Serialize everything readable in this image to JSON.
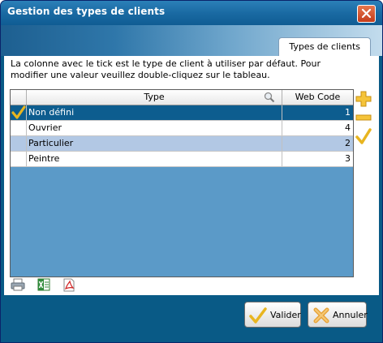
{
  "window": {
    "title": "Gestion des types de clients"
  },
  "banner": {
    "tab_label": "Types de clients"
  },
  "description": "La colonne avec le tick est le type de client à utiliser par défaut. Pour modifier une valeur veuillez double-cliquez sur le tableau.",
  "grid": {
    "columns": [
      "Type",
      "Web Code"
    ],
    "rows": [
      {
        "type": "Non défini",
        "web_code": "1",
        "default": true
      },
      {
        "type": "Ouvrier",
        "web_code": "4",
        "default": false
      },
      {
        "type": "Particulier",
        "web_code": "2",
        "default": false
      },
      {
        "type": "Peintre",
        "web_code": "3",
        "default": false
      }
    ]
  },
  "side_tools": [
    "add-icon",
    "remove-icon",
    "set-default-icon"
  ],
  "export_tools": [
    "print-icon",
    "excel-icon",
    "pdf-icon"
  ],
  "buttons": {
    "ok_label": "Valider",
    "cancel_label": "Annuler"
  },
  "colors": {
    "title_bar": "#1a6aa3",
    "selected_row": "#0d5d8f",
    "alt_row": "#b2c8e4",
    "grid_bg": "#5b9ac8",
    "footer": "#095a86"
  }
}
